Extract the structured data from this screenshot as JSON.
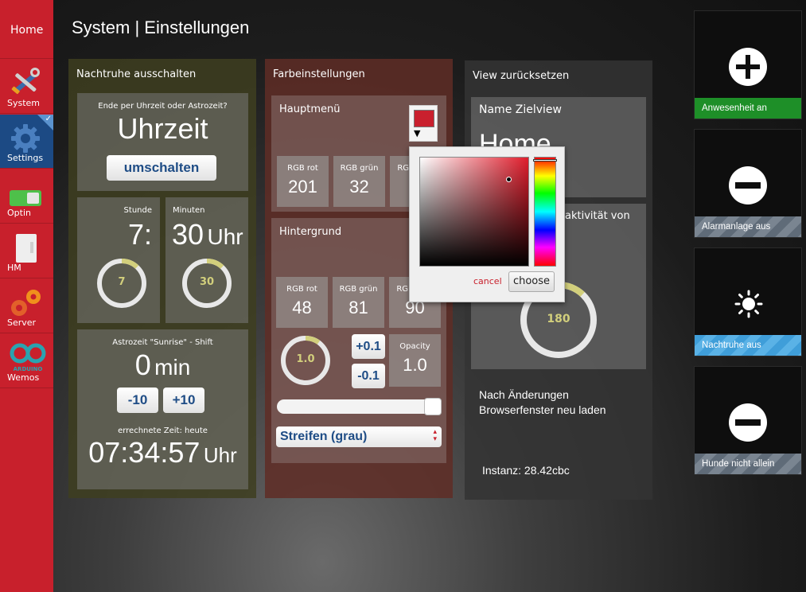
{
  "sidebar": {
    "home": "Home",
    "items": [
      {
        "label": "System",
        "icon": "tools-icon"
      },
      {
        "label": "Settings",
        "icon": "gear-icon"
      },
      {
        "label": "Optin",
        "icon": "toggle-icon"
      },
      {
        "label": "HM",
        "icon": "device-icon"
      },
      {
        "label": "Server",
        "icon": "gears-icon"
      },
      {
        "label": "Wemos",
        "icon": "arduino-icon"
      }
    ],
    "arduino_text": "ARDUINO",
    "check_mark": "✓"
  },
  "page_title": "System | Einstellungen",
  "nachtruhe": {
    "title": "Nachtruhe ausschalten",
    "mode_question": "Ende per Uhrzeit oder Astrozeit?",
    "mode_value": "Uhrzeit",
    "toggle_button": "umschalten",
    "stunde_label": "Stunde",
    "stunde_value": "7:",
    "minuten_label": "Minuten",
    "minuten_value": "30",
    "minuten_unit": "Uhr",
    "ring_hour": "7",
    "ring_hour_fraction": 0.29,
    "ring_min": "30",
    "ring_min_fraction": 0.5,
    "astro_label": "Astrozeit \"Sunrise\" - Shift",
    "astro_value": "0",
    "astro_unit": "min",
    "minus_btn": "-10",
    "plus_btn": "+10",
    "calc_label": "errechnete Zeit: heute",
    "calc_value": "07:34:57",
    "calc_unit": "Uhr"
  },
  "farben": {
    "title": "Farbeinstellungen",
    "hauptmenu": {
      "title": "Hauptmenü",
      "rgb_rot_label": "RGB rot",
      "rgb_rot": "201",
      "rgb_gruen_label": "RGB grün",
      "rgb_gruen": "32",
      "rgb_blau_label": "RGB blau",
      "swatch_color": "#c9202e"
    },
    "hintergrund": {
      "title": "Hintergrund",
      "rgb_rot_label": "RGB rot",
      "rgb_rot": "48",
      "rgb_gruen_label": "RGB grün",
      "rgb_gruen": "81",
      "rgb_blau_label": "RGB blau",
      "rgb_blau": "90",
      "ring_value": "1.0",
      "ring_fraction": 0.1,
      "plus_btn": "+0.1",
      "minus_btn": "-0.1",
      "opacity_label": "Opacity",
      "opacity_value": "1.0",
      "slider_value": 1.0,
      "select_value": "Streifen (grau)"
    },
    "picker": {
      "cancel": "cancel",
      "choose": "choose"
    }
  },
  "view": {
    "title": "View zurücksetzen",
    "name_label": "Name Zielview",
    "name_value": "Home",
    "inactivity_label": "aktivität von",
    "ring_value": "180",
    "ring_fraction": 0.12,
    "note_line1": "Nach Änderungen",
    "note_line2": "Browserfenster neu laden",
    "instanz": "Instanz: 28.42cbc"
  },
  "widgets": [
    {
      "label": "Anwesenheit an",
      "icon": "plus-circle-icon",
      "color": "#1e8f28"
    },
    {
      "label": "Alarmanlage aus",
      "icon": "minus-circle-icon",
      "color": "#6a7580"
    },
    {
      "label": "Nachtruhe aus",
      "icon": "sun-icon",
      "color": "#3f9ed9"
    },
    {
      "label": "Hunde nicht allein",
      "icon": "minus-circle-icon",
      "color": "#6a7580"
    }
  ]
}
